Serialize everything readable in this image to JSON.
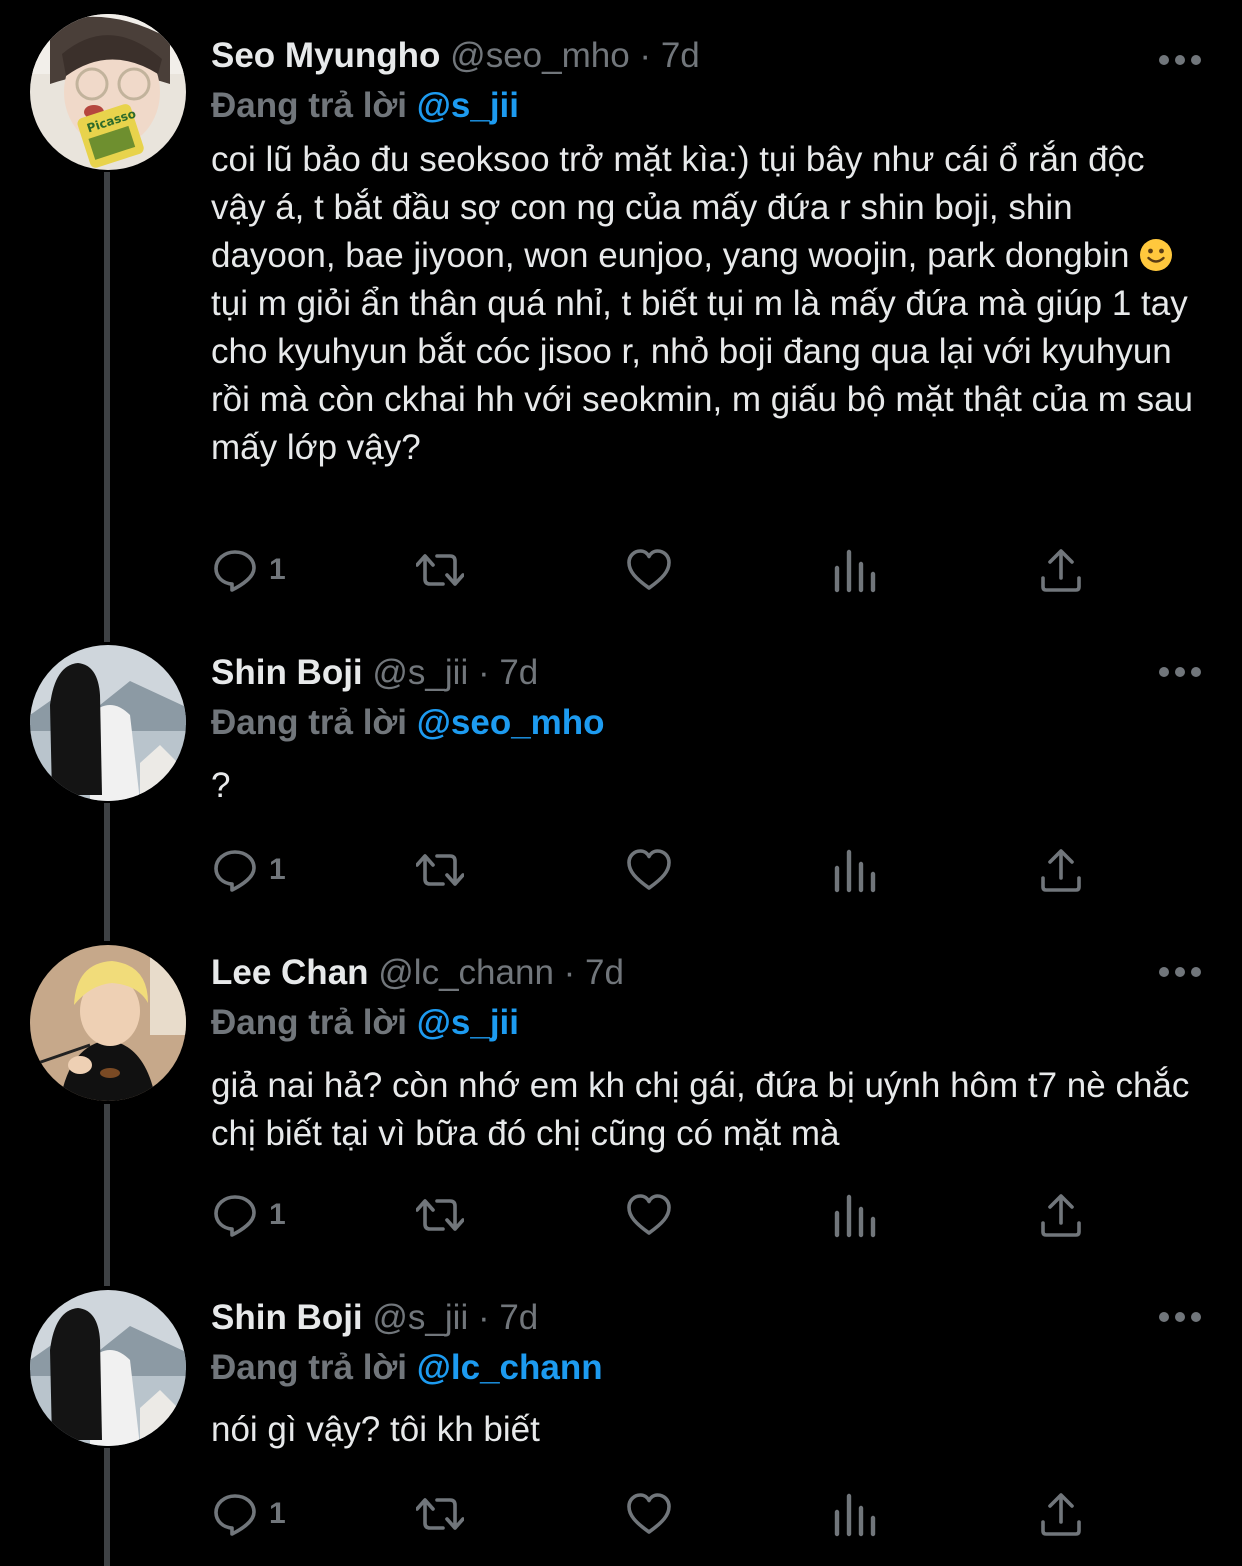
{
  "reply_prefix": "Đang trả lời",
  "colors": {
    "background": "#000000",
    "text": "#e7e9ea",
    "muted": "#71767b",
    "accent": "#1d9bf0",
    "thread_line": "#3e4144"
  },
  "tweets": [
    {
      "name": "Seo Myungho",
      "handle": "@seo_mho",
      "time": "7d",
      "reply_to": "@s_jii",
      "text_before_emoji": "coi lũ bảo đu seoksoo trở mặt kìa:) tụi bây như cái ổ rắn độc vậy á, t bắt đầu sợ con ng của mấy đứa r shin boji, shin dayoon, bae jiyoon, won eunjoo, yang woojin, park dongbin",
      "emoji": "slightly-smiling-face",
      "text_after_emoji": " tụi m giỏi ẩn thân quá nhỉ, t biết tụi m là mấy đứa mà giúp 1 tay cho kyuhyun bắt cóc jisoo r, nhỏ boji đang qua lại với kyuhyun rồi mà còn ckhai hh với seokmin, m giấu bộ mặt thật của m sau mấy lớp vậy?",
      "reply_count": "1",
      "avatar_label": "Picasso"
    },
    {
      "name": "Shin Boji",
      "handle": "@s_jii",
      "time": "7d",
      "reply_to": "@seo_mho",
      "text": "?",
      "reply_count": "1"
    },
    {
      "name": "Lee Chan",
      "handle": "@lc_chann",
      "time": "7d",
      "reply_to": "@s_jii",
      "text": "giả nai hả? còn nhớ em kh chị gái, đứa bị uýnh hôm t7 nè chắc chị biết tại vì bữa đó chị cũng có mặt mà",
      "reply_count": "1"
    },
    {
      "name": "Shin Boji",
      "handle": "@s_jii",
      "time": "7d",
      "reply_to": "@lc_chann",
      "text": "nói gì vậy? tôi kh biết",
      "reply_count": "1"
    }
  ],
  "icons": {
    "reply": "reply-icon",
    "retweet": "retweet-icon",
    "like": "heart-icon",
    "views": "views-icon",
    "share": "share-icon",
    "more": "more-icon"
  }
}
